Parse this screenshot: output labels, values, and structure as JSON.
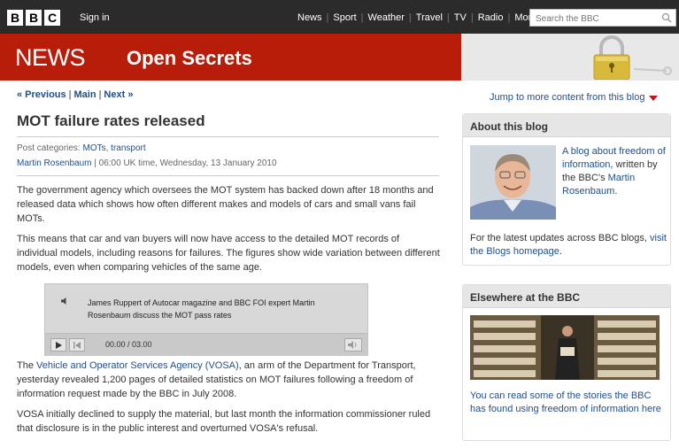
{
  "topbar": {
    "logo_letters": [
      "B",
      "B",
      "C"
    ],
    "signin": "Sign in",
    "nav": [
      "News",
      "Sport",
      "Weather",
      "Travel",
      "TV",
      "Radio"
    ],
    "more": "More",
    "search_placeholder": "Search the BBC"
  },
  "banner": {
    "section": "NEWS",
    "blog_title": "Open Secrets",
    "color": "#b81d0a"
  },
  "post_nav": {
    "previous": "« Previous",
    "main": "Main",
    "next": "Next »",
    "jump": "Jump to more content from this blog"
  },
  "post": {
    "title": "MOT failure rates released",
    "categories_label": "Post categories:",
    "categories": [
      "MOTs",
      "transport"
    ],
    "author": "Martin Rosenbaum",
    "datetime": "| 06:00 UK time, Wednesday, 13 January 2010",
    "p1": "The government agency which oversees the MOT system has backed down after 18 months and released data which shows how often different makes and models of cars and small vans fail MOTs.",
    "p2": "This means that car and van buyers will now have access to the detailed MOT records of individual models, including reasons for failures. The figures show wide variation between different models, even when comparing vehicles of the same age.",
    "p3_before": "The ",
    "p3_link": "Vehicle and Operator Services Agency (VOSA)",
    "p3_after": ", an arm of the Department for Transport, yesterday revealed 1,200 pages of detailed statistics on MOT failures following a freedom of information request made by the BBC in July 2008.",
    "p4": "VOSA initially declined to supply the material, but last month the information commissioner ruled that disclosure is in the public interest and overturned VOSA's refusal."
  },
  "player": {
    "caption": "James Ruppert of Autocar magazine and BBC FOI expert Martin Rosenbaum discuss the MOT pass rates",
    "time": "00.00 / 03.00"
  },
  "sidebar": {
    "about": {
      "heading": "About this blog",
      "text_link": "A blog about freedom of information",
      "text_mid": ", written by the BBC's ",
      "author_link": "Martin Rosenbaum",
      "text_end": ".",
      "latest": "For the latest updates across BBC blogs, ",
      "latest_link": "visit the Blogs homepage",
      "latest_end": "."
    },
    "elsewhere": {
      "heading": "Elsewhere at the BBC",
      "text": "You can read some of the stories the BBC has found using freedom of information here"
    }
  },
  "colors": {
    "link": "#1e4e8c",
    "accent_red": "#c0141b"
  }
}
